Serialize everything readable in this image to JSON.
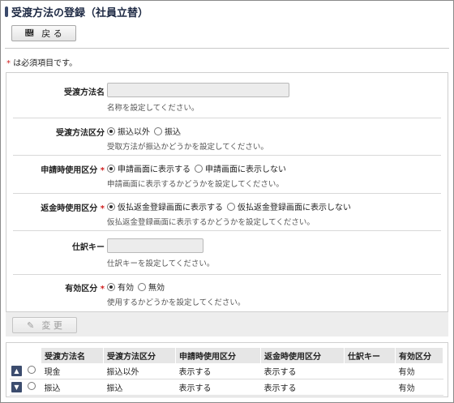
{
  "page": {
    "title": "受渡方法の登録（社員立替）"
  },
  "toolbar": {
    "back_label": "戻 る",
    "back_icon": "arrow-left-icon"
  },
  "required_note": {
    "star": "*",
    "text": "は必須項目です。"
  },
  "form": {
    "name": {
      "label": "受渡方法名",
      "value": "",
      "hint": "名称を設定してください。"
    },
    "method_type": {
      "label": "受渡方法区分",
      "options": [
        "振込以外",
        "振込"
      ],
      "selected": "振込以外",
      "hint": "受取方法が振込かどうかを設定してください。"
    },
    "apply_use": {
      "label": "申請時使用区分",
      "required": "*",
      "options": [
        "申請画面に表示する",
        "申請画面に表示しない"
      ],
      "selected": "申請画面に表示する",
      "hint": "申請画面に表示するかどうかを設定してください。"
    },
    "refund_use": {
      "label": "返金時使用区分",
      "required": "*",
      "options": [
        "仮払返金登録画面に表示する",
        "仮払返金登録画面に表示しない"
      ],
      "selected": "仮払返金登録画面に表示する",
      "hint": "仮払返金登録画面に表示するかどうかを設定してください。"
    },
    "journal_key": {
      "label": "仕訳キー",
      "value": "",
      "hint": "仕訳キーを設定してください。"
    },
    "valid": {
      "label": "有効区分",
      "required": "*",
      "options": [
        "有効",
        "無効"
      ],
      "selected": "有効",
      "hint": "使用するかどうかを設定してください。"
    }
  },
  "footer": {
    "change_label": "変 更",
    "change_icon": "pencil-icon"
  },
  "list": {
    "columns": [
      "受渡方法名",
      "受渡方法区分",
      "申請時使用区分",
      "返金時使用区分",
      "仕訳キー",
      "有効区分"
    ],
    "rows": [
      {
        "arrow": "up-arrow-icon",
        "cells": [
          "現金",
          "振込以外",
          "表示する",
          "表示する",
          "",
          "有効"
        ]
      },
      {
        "arrow": "down-arrow-icon",
        "cells": [
          "振込",
          "振込",
          "表示する",
          "表示する",
          "",
          "有効"
        ]
      }
    ]
  },
  "colors": {
    "title_marker": "#3b4a6b",
    "required": "#d01c1c",
    "sort_button": "#3c4c6e"
  }
}
